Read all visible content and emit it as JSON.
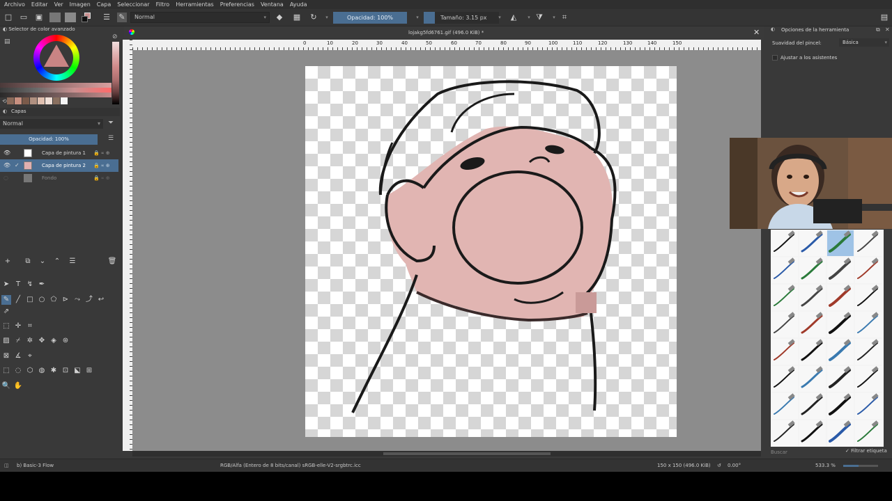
{
  "menu": [
    "Archivo",
    "Editar",
    "Ver",
    "Imagen",
    "Capa",
    "Seleccionar",
    "Filtro",
    "Herramientas",
    "Preferencias",
    "Ventana",
    "Ayuda"
  ],
  "toolbar": {
    "blend_mode": "Normal",
    "opacity": "Opacidad: 100%",
    "size": "Tamaño: 3.15 px"
  },
  "color_selector": {
    "title": "Selector de color avanzado"
  },
  "layers": {
    "title": "Capas",
    "blend_mode": "Normal",
    "opacity": "Opacidad:  100%",
    "items": [
      {
        "name": "Capa de pintura 1",
        "visible": true,
        "selected": false
      },
      {
        "name": "Capa de pintura 2",
        "visible": true,
        "selected": true
      },
      {
        "name": "Fondo",
        "visible": false,
        "selected": false
      }
    ]
  },
  "document": {
    "title": "lojakg5fd6761.gif (496.0 KiB) *"
  },
  "ruler": {
    "top_ticks": [
      "0",
      "10",
      "20",
      "30",
      "40",
      "50",
      "60",
      "70",
      "80",
      "90",
      "100",
      "110",
      "120",
      "130",
      "140",
      "150"
    ]
  },
  "tool_options": {
    "title": "Opciones de la herramienta",
    "smoothing_label": "Suavidad del pincel:",
    "smoothing_value": "Básica",
    "snap_label": "Ajustar a los asistentes"
  },
  "brush_presets": {
    "search_placeholder": "Buscar",
    "filter_label": "Filtrar etiqueta"
  },
  "status": {
    "preset": "b) Basic-3 Flow",
    "colorspace": "RGB/Alfa (Entero de 8 bits/canal)  sRGB-elle-V2-srgbtrc.icc",
    "dimensions": "150 x 150 (496.0 KiB)",
    "rotation": "0.00°",
    "zoom": "533.3 %"
  },
  "colors": {
    "accent": "#4a6e92",
    "skin": "#e1b5b2",
    "swatch_pink": "#c88f8f"
  }
}
